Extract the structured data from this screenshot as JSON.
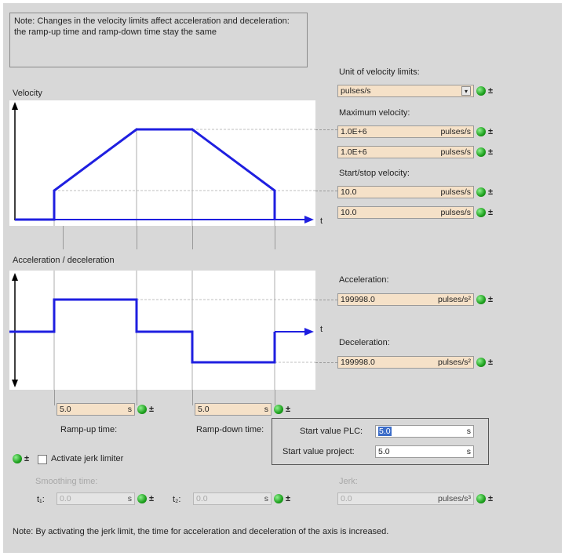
{
  "note_top": "Note: Changes in the velocity limits affect acceleration and deceleration: the ramp-up time and ramp-down time stay the same",
  "velocity": {
    "graph_label": "Velocity",
    "axis_t": "t",
    "unit_label": "Unit of velocity limits:",
    "unit_value": "pulses/s",
    "max_label": "Maximum velocity:",
    "max_values": [
      {
        "value": "1.0E+6",
        "unit": "pulses/s"
      },
      {
        "value": "1.0E+6",
        "unit": "pulses/s"
      }
    ],
    "startstop_label": "Start/stop velocity:",
    "startstop_values": [
      {
        "value": "10.0",
        "unit": "pulses/s"
      },
      {
        "value": "10.0",
        "unit": "pulses/s"
      }
    ]
  },
  "accel": {
    "graph_label": "Acceleration / deceleration",
    "axis_t": "t",
    "acc_label": "Acceleration:",
    "acc_value": "199998.0",
    "acc_unit": "pulses/s²",
    "dec_label": "Deceleration:",
    "dec_value": "199998.0",
    "dec_unit": "pulses/s²"
  },
  "ramp": {
    "up_value": "5.0",
    "up_unit": "s",
    "up_label": "Ramp-up time:",
    "down_value": "5.0",
    "down_unit": "s",
    "down_label": "Ramp-down time:"
  },
  "popup": {
    "plc_label": "Start value PLC:",
    "plc_value": "5.0",
    "plc_unit": "s",
    "project_label": "Start value project:",
    "project_value": "5.0",
    "project_unit": "s"
  },
  "jerk": {
    "activate_label": "Activate jerk limiter",
    "smoothing_label": "Smoothing time:",
    "t1_label": "t₁:",
    "t1_value": "0.0",
    "t1_unit": "s",
    "t2_label": "t₂:",
    "t2_value": "0.0",
    "t2_unit": "s",
    "jerk_label": "Jerk:",
    "jerk_value": "0.0",
    "jerk_unit": "pulses/s³"
  },
  "note_bottom": "Note: By activating the jerk limit, the time for acceleration and deceleration of the axis is increased.",
  "colors": {
    "curve": "#1f1fe0",
    "field": "#f5e1c8",
    "status_ok": "#1ea01e"
  }
}
